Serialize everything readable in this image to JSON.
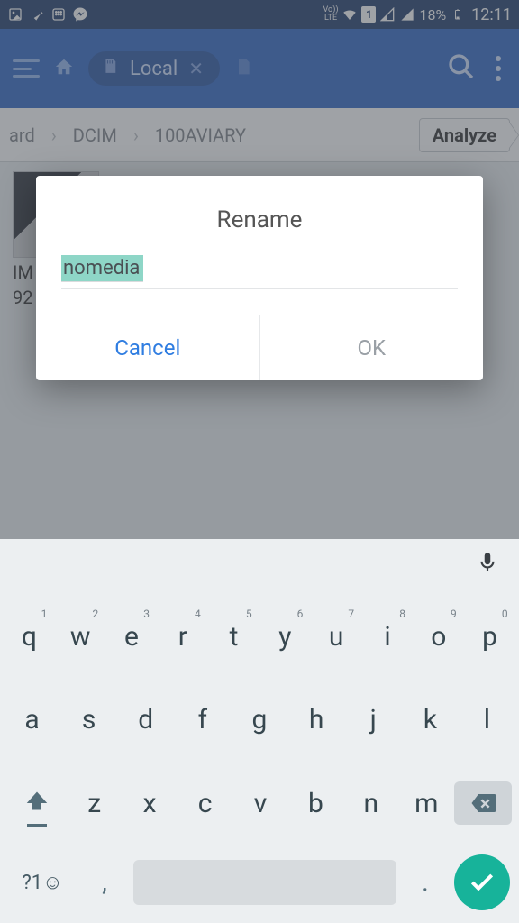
{
  "status": {
    "battery_pct": "18%",
    "time": "12:11",
    "lte": "LTE"
  },
  "header": {
    "chip_label": "Local"
  },
  "breadcrumb": {
    "seg0": "ard",
    "seg1": "DCIM",
    "seg2": "100AVIARY",
    "analyze": "Analyze"
  },
  "file": {
    "line1": "IM",
    "line2": "92"
  },
  "dialog": {
    "title": "Rename",
    "value": "nomedia",
    "cancel": "Cancel",
    "ok": "OK"
  },
  "keyboard": {
    "row1": [
      {
        "k": "q",
        "n": "1"
      },
      {
        "k": "w",
        "n": "2"
      },
      {
        "k": "e",
        "n": "3"
      },
      {
        "k": "r",
        "n": "4"
      },
      {
        "k": "t",
        "n": "5"
      },
      {
        "k": "y",
        "n": "6"
      },
      {
        "k": "u",
        "n": "7"
      },
      {
        "k": "i",
        "n": "8"
      },
      {
        "k": "o",
        "n": "9"
      },
      {
        "k": "p",
        "n": "0"
      }
    ],
    "row2": [
      "a",
      "s",
      "d",
      "f",
      "g",
      "h",
      "j",
      "k",
      "l"
    ],
    "row3": [
      "z",
      "x",
      "c",
      "v",
      "b",
      "n",
      "m"
    ],
    "sym": "?1☺",
    "comma": ",",
    "period": "."
  }
}
